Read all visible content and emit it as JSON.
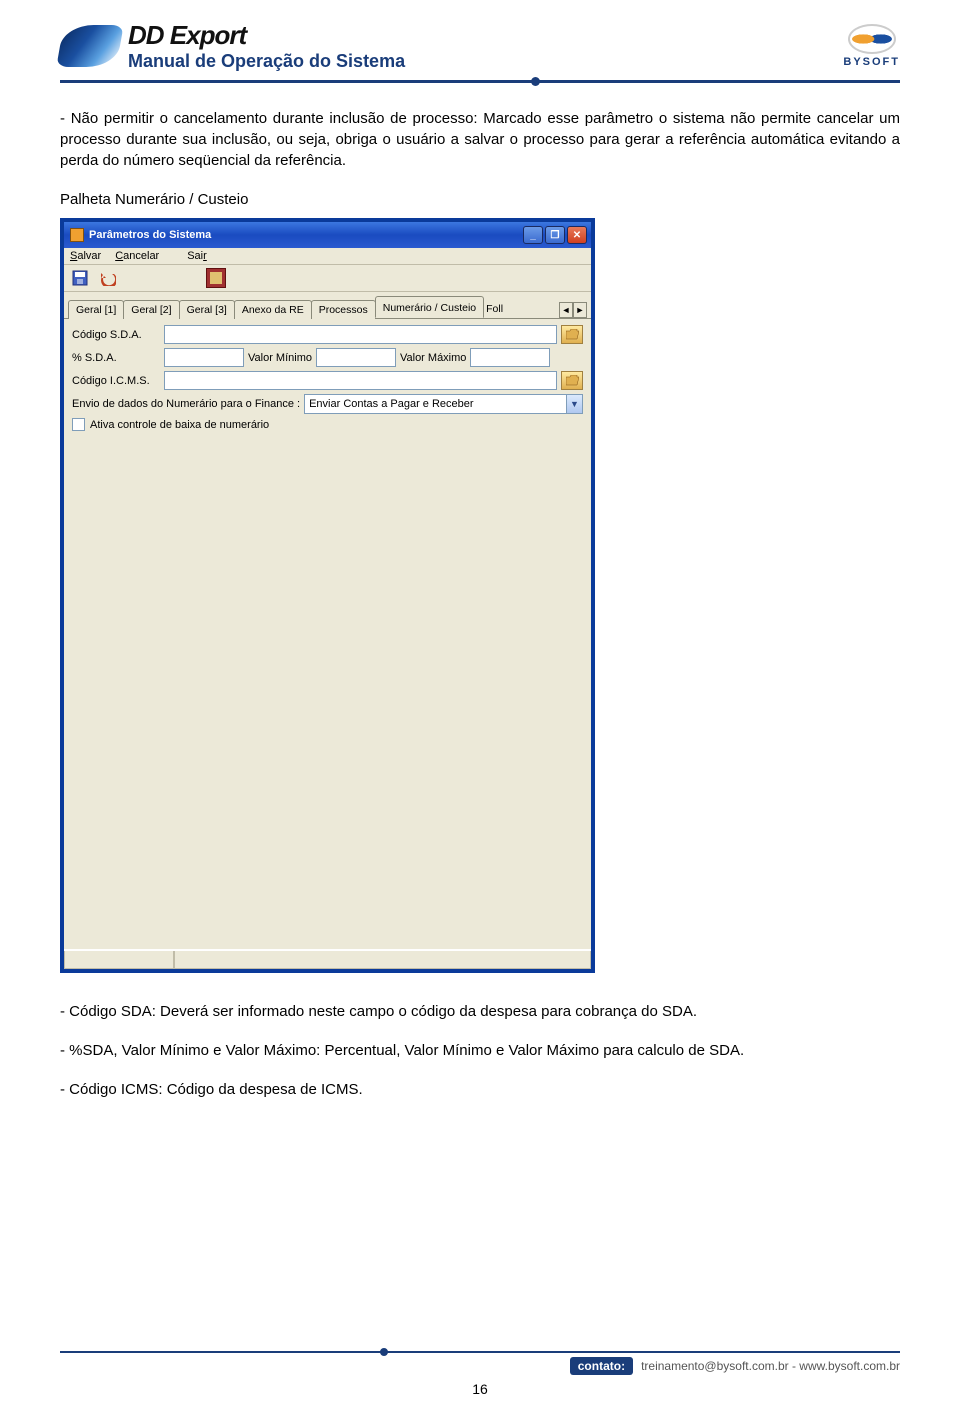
{
  "header": {
    "product_title": "DD Export",
    "product_subtitle": "Manual de Operação do Sistema",
    "company": "BYSOFT"
  },
  "intro_paragraph": "- Não permitir o cancelamento durante inclusão de processo: Marcado esse parâmetro o sistema não permite cancelar um processo durante sua inclusão, ou seja, obriga o usuário a salvar o processo para gerar a referência automática evitando a perda do número seqüencial da referência.",
  "section_title": "Palheta Numerário / Custeio",
  "window": {
    "title": "Parâmetros do Sistema",
    "menu": {
      "salvar": "Salvar",
      "cancelar": "Cancelar",
      "sair": "Sair"
    },
    "tabs": {
      "geral1": "Geral [1]",
      "geral2": "Geral [2]",
      "geral3": "Geral [3]",
      "anexo": "Anexo da RE",
      "processos": "Processos",
      "numerario": "Numerário / Custeio",
      "overflow": "Foll"
    },
    "form": {
      "codigo_sda_label": "Código S.D.A.",
      "codigo_sda_value": "",
      "pct_sda_label": "% S.D.A.",
      "pct_sda_value": "",
      "valor_minimo_label": "Valor Mínimo",
      "valor_minimo_value": "",
      "valor_maximo_label": "Valor Máximo",
      "valor_maximo_value": "",
      "codigo_icms_label": "Código I.C.M.S.",
      "codigo_icms_value": "",
      "envio_label": "Envio de dados do Numerário para o Finance :",
      "envio_value": "Enviar Contas a Pagar e Receber",
      "checkbox_label": "Ativa controle de baixa de numerário"
    }
  },
  "lower": {
    "p1": "- Código SDA: Deverá ser informado neste campo o código da despesa para cobrança do SDA.",
    "p2": "- %SDA, Valor Mínimo e Valor Máximo: Percentual, Valor Mínimo e Valor Máximo para calculo de SDA.",
    "p3": "- Código ICMS: Código da despesa de ICMS."
  },
  "footer": {
    "contact_label": "contato:",
    "contact_text": "treinamento@bysoft.com.br - www.bysoft.com.br"
  },
  "page_number": "16"
}
